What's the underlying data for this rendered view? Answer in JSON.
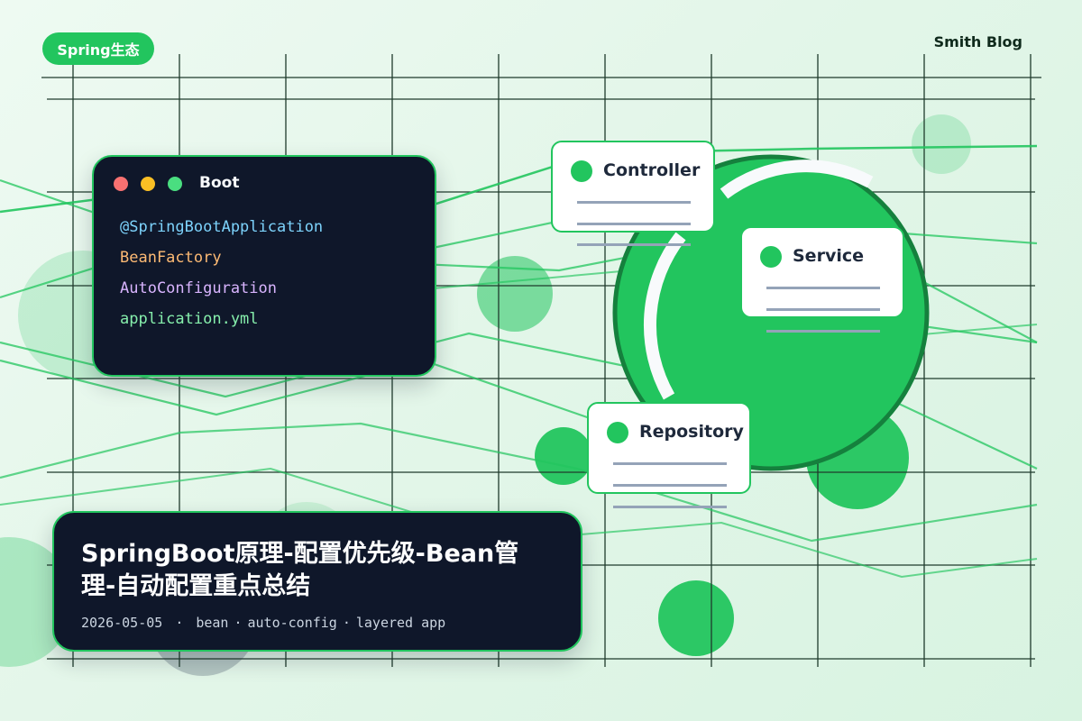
{
  "header": {
    "category_tag": "Spring生态",
    "blog_name": "Smith Blog"
  },
  "code_card": {
    "title": "Boot",
    "lines": [
      {
        "text": "@SpringBootApplication",
        "color": "#7dd3fc"
      },
      {
        "text": "BeanFactory",
        "color": "#fdba74"
      },
      {
        "text": "AutoConfiguration",
        "color": "#d8b4fe"
      },
      {
        "text": "application.yml",
        "color": "#86efac"
      }
    ]
  },
  "diagram": {
    "nodes": [
      {
        "label": "Controller"
      },
      {
        "label": "Service"
      },
      {
        "label": "Repository"
      }
    ]
  },
  "article": {
    "title": "SpringBoot原理-配置优先级-Bean管理-自动配置重点总结",
    "date": "2026-05-05",
    "separator": "·",
    "tags": [
      "bean",
      "auto-config",
      "layered app"
    ]
  },
  "colors": {
    "accent": "#22c55e",
    "dark_card": "#0f172a",
    "grid": "#1f3b2c"
  }
}
